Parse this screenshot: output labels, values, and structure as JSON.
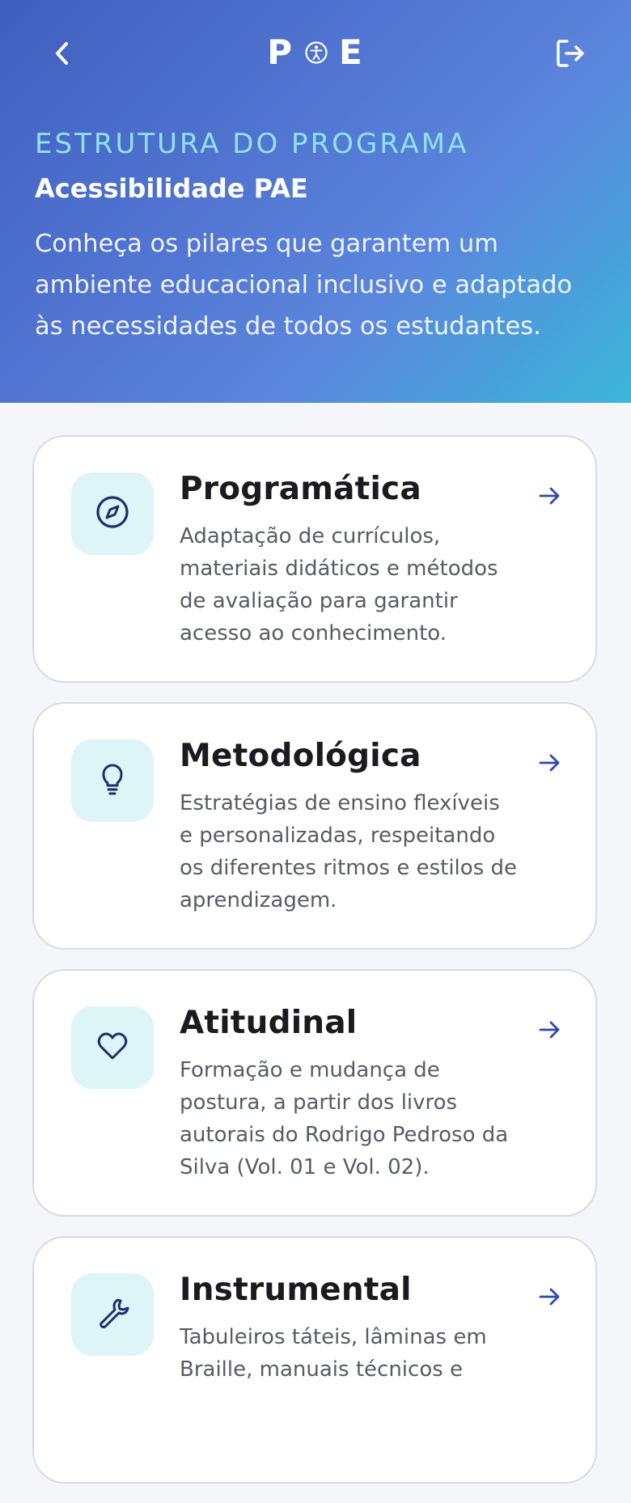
{
  "header": {
    "logo_left": "P",
    "logo_right": "E",
    "back_icon": "chevron-left-icon",
    "logout_icon": "logout-icon",
    "eyebrow": "ESTRUTURA DO PROGRAMA",
    "title": "Acessibilidade PAE",
    "description": "Conheça os pilares que garantem um ambiente educacional inclusivo e adaptado às necessidades de todos os estudantes."
  },
  "cards": [
    {
      "title": "Programática",
      "description": "Adaptação de currículos, materiais didáticos e métodos de avaliação para garantir acesso ao conhecimento.",
      "icon": "compass-icon"
    },
    {
      "title": "Metodológica",
      "description": "Estratégias de ensino flexíveis e personalizadas, respeitando os diferentes ritmos e estilos de aprendizagem.",
      "icon": "lightbulb-icon"
    },
    {
      "title": "Atitudinal",
      "description": "Formação e mudança de postura, a partir dos livros autorais do Rodrigo Pedroso da Silva (Vol. 01 e Vol. 02).",
      "icon": "heart-icon"
    },
    {
      "title": "Instrumental",
      "description": "Tabuleiros táteis, lâminas em Braille, manuais técnicos e",
      "icon": "wrench-icon"
    }
  ],
  "colors": {
    "hero_start": "#3f5fbf",
    "hero_end": "#3bb6d8",
    "eyebrow": "#8fe2ef",
    "icon_bg": "#def5f8",
    "icon_stroke": "#1f2f6b",
    "arrow": "#2f4aa8"
  }
}
